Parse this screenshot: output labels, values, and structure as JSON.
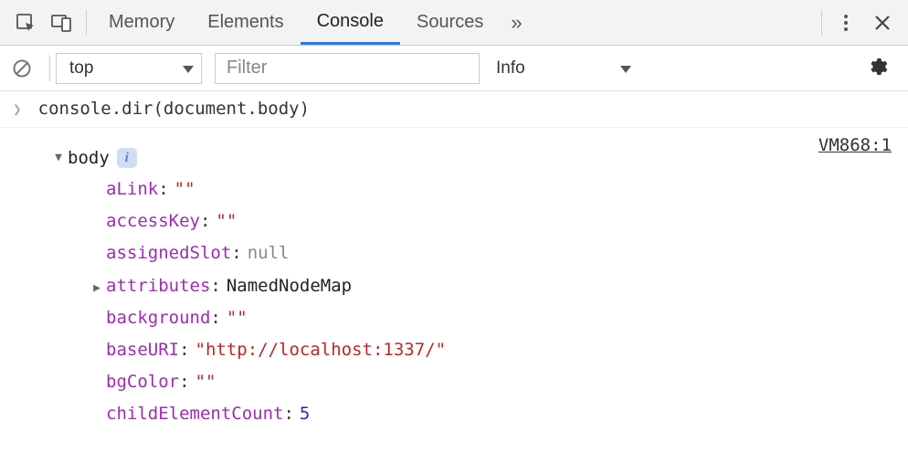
{
  "toolbar": {
    "tabs": [
      "Memory",
      "Elements",
      "Console",
      "Sources"
    ],
    "activeTab": "Console"
  },
  "subtoolbar": {
    "context": "top",
    "filterPlaceholder": "Filter",
    "level": "Info"
  },
  "console": {
    "command": "console.dir(document.body)",
    "sourceRef": "VM868:1",
    "object": {
      "name": "body",
      "properties": [
        {
          "key": "aLink",
          "valueDisplay": "\"\"",
          "type": "string"
        },
        {
          "key": "accessKey",
          "valueDisplay": "\"\"",
          "type": "string"
        },
        {
          "key": "assignedSlot",
          "valueDisplay": "null",
          "type": "null"
        },
        {
          "key": "attributes",
          "valueDisplay": "NamedNodeMap",
          "type": "object",
          "expandable": true
        },
        {
          "key": "background",
          "valueDisplay": "\"\"",
          "type": "string"
        },
        {
          "key": "baseURI",
          "valueDisplay": "\"http://localhost:1337/\"",
          "type": "string"
        },
        {
          "key": "bgColor",
          "valueDisplay": "\"\"",
          "type": "string"
        },
        {
          "key": "childElementCount",
          "valueDisplay": "5",
          "type": "number"
        }
      ]
    }
  }
}
